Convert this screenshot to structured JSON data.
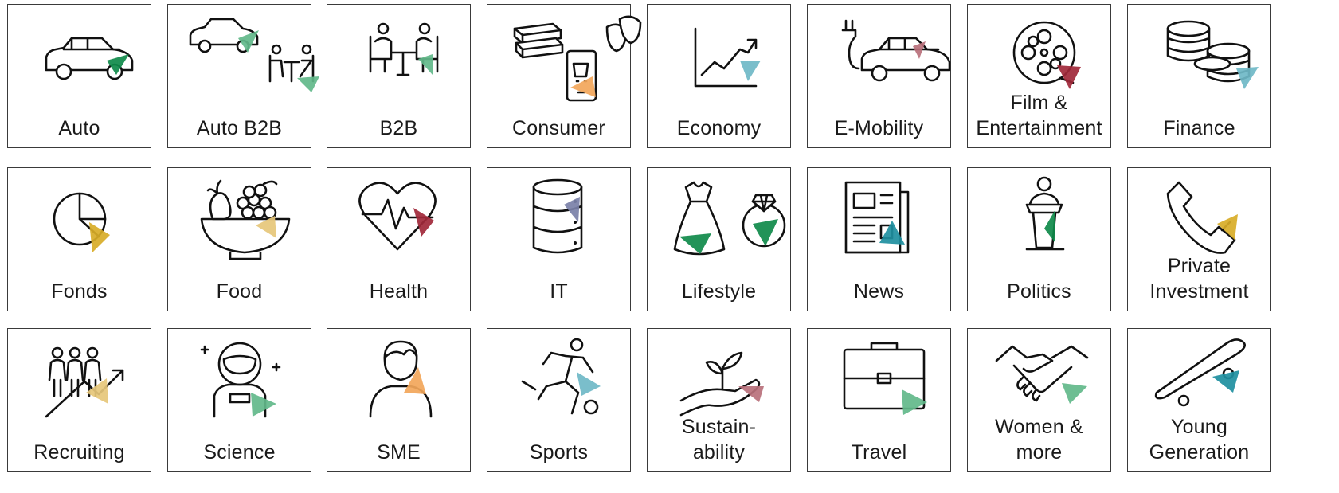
{
  "colors": {
    "green": "#0f8a4a",
    "light_green": "#62b88a",
    "teal": "#6fb8c7",
    "dark_teal": "#1e8fa0",
    "orange": "#f2a65a",
    "wine": "#a1283a",
    "rose": "#b9707b",
    "gold": "#d8ac27",
    "sand": "#e6c77a",
    "slate": "#7a80a8",
    "black": "#111111"
  },
  "tiles": [
    {
      "label": "Auto",
      "icon": "car-icon",
      "accent": "green"
    },
    {
      "label": "Auto B2B",
      "icon": "car-meeting-icon",
      "accent": "light_green"
    },
    {
      "label": "B2B",
      "icon": "meeting-icon",
      "accent": "light_green"
    },
    {
      "label": "Consumer",
      "icon": "books-phone-masks-icon",
      "accent": "orange"
    },
    {
      "label": "Economy",
      "icon": "rising-chart-icon",
      "accent": "teal"
    },
    {
      "label": "E-Mobility",
      "icon": "electric-car-icon",
      "accent": "rose"
    },
    {
      "label": "Film &",
      "label2": "Entertainment",
      "icon": "film-reel-icon",
      "accent": "wine"
    },
    {
      "label": "Finance",
      "icon": "coin-stacks-icon",
      "accent": "teal"
    },
    {
      "label": "Fonds",
      "icon": "pie-chart-icon",
      "accent": "gold"
    },
    {
      "label": "Food",
      "icon": "fruit-bowl-icon",
      "accent": "sand"
    },
    {
      "label": "Health",
      "icon": "heartbeat-icon",
      "accent": "wine"
    },
    {
      "label": "IT",
      "icon": "database-icon",
      "accent": "slate"
    },
    {
      "label": "Lifestyle",
      "icon": "dress-ring-icon",
      "accent": "green"
    },
    {
      "label": "News",
      "icon": "newspaper-icon",
      "accent": "dark_teal"
    },
    {
      "label": "Politics",
      "icon": "speaker-podium-icon",
      "accent": "green"
    },
    {
      "label": "Private",
      "label2": "Investment",
      "icon": "telephone-icon",
      "accent": "gold"
    },
    {
      "label": "Recruiting",
      "icon": "people-growth-icon",
      "accent": "sand"
    },
    {
      "label": "Science",
      "icon": "astronaut-icon",
      "accent": "light_green"
    },
    {
      "label": "SME",
      "icon": "person-icon",
      "accent": "orange"
    },
    {
      "label": "Sports",
      "icon": "soccer-player-icon",
      "accent": "teal"
    },
    {
      "label": "Sustain-",
      "label2": "ability",
      "icon": "hand-plant-icon",
      "accent": "rose"
    },
    {
      "label": "Travel",
      "icon": "briefcase-icon",
      "accent": "light_green"
    },
    {
      "label": "Women &",
      "label2": "more",
      "icon": "handshake-icon",
      "accent": "light_green"
    },
    {
      "label": "Young",
      "label2": "Generation",
      "icon": "skateboard-icon",
      "accent": "dark_teal"
    }
  ]
}
